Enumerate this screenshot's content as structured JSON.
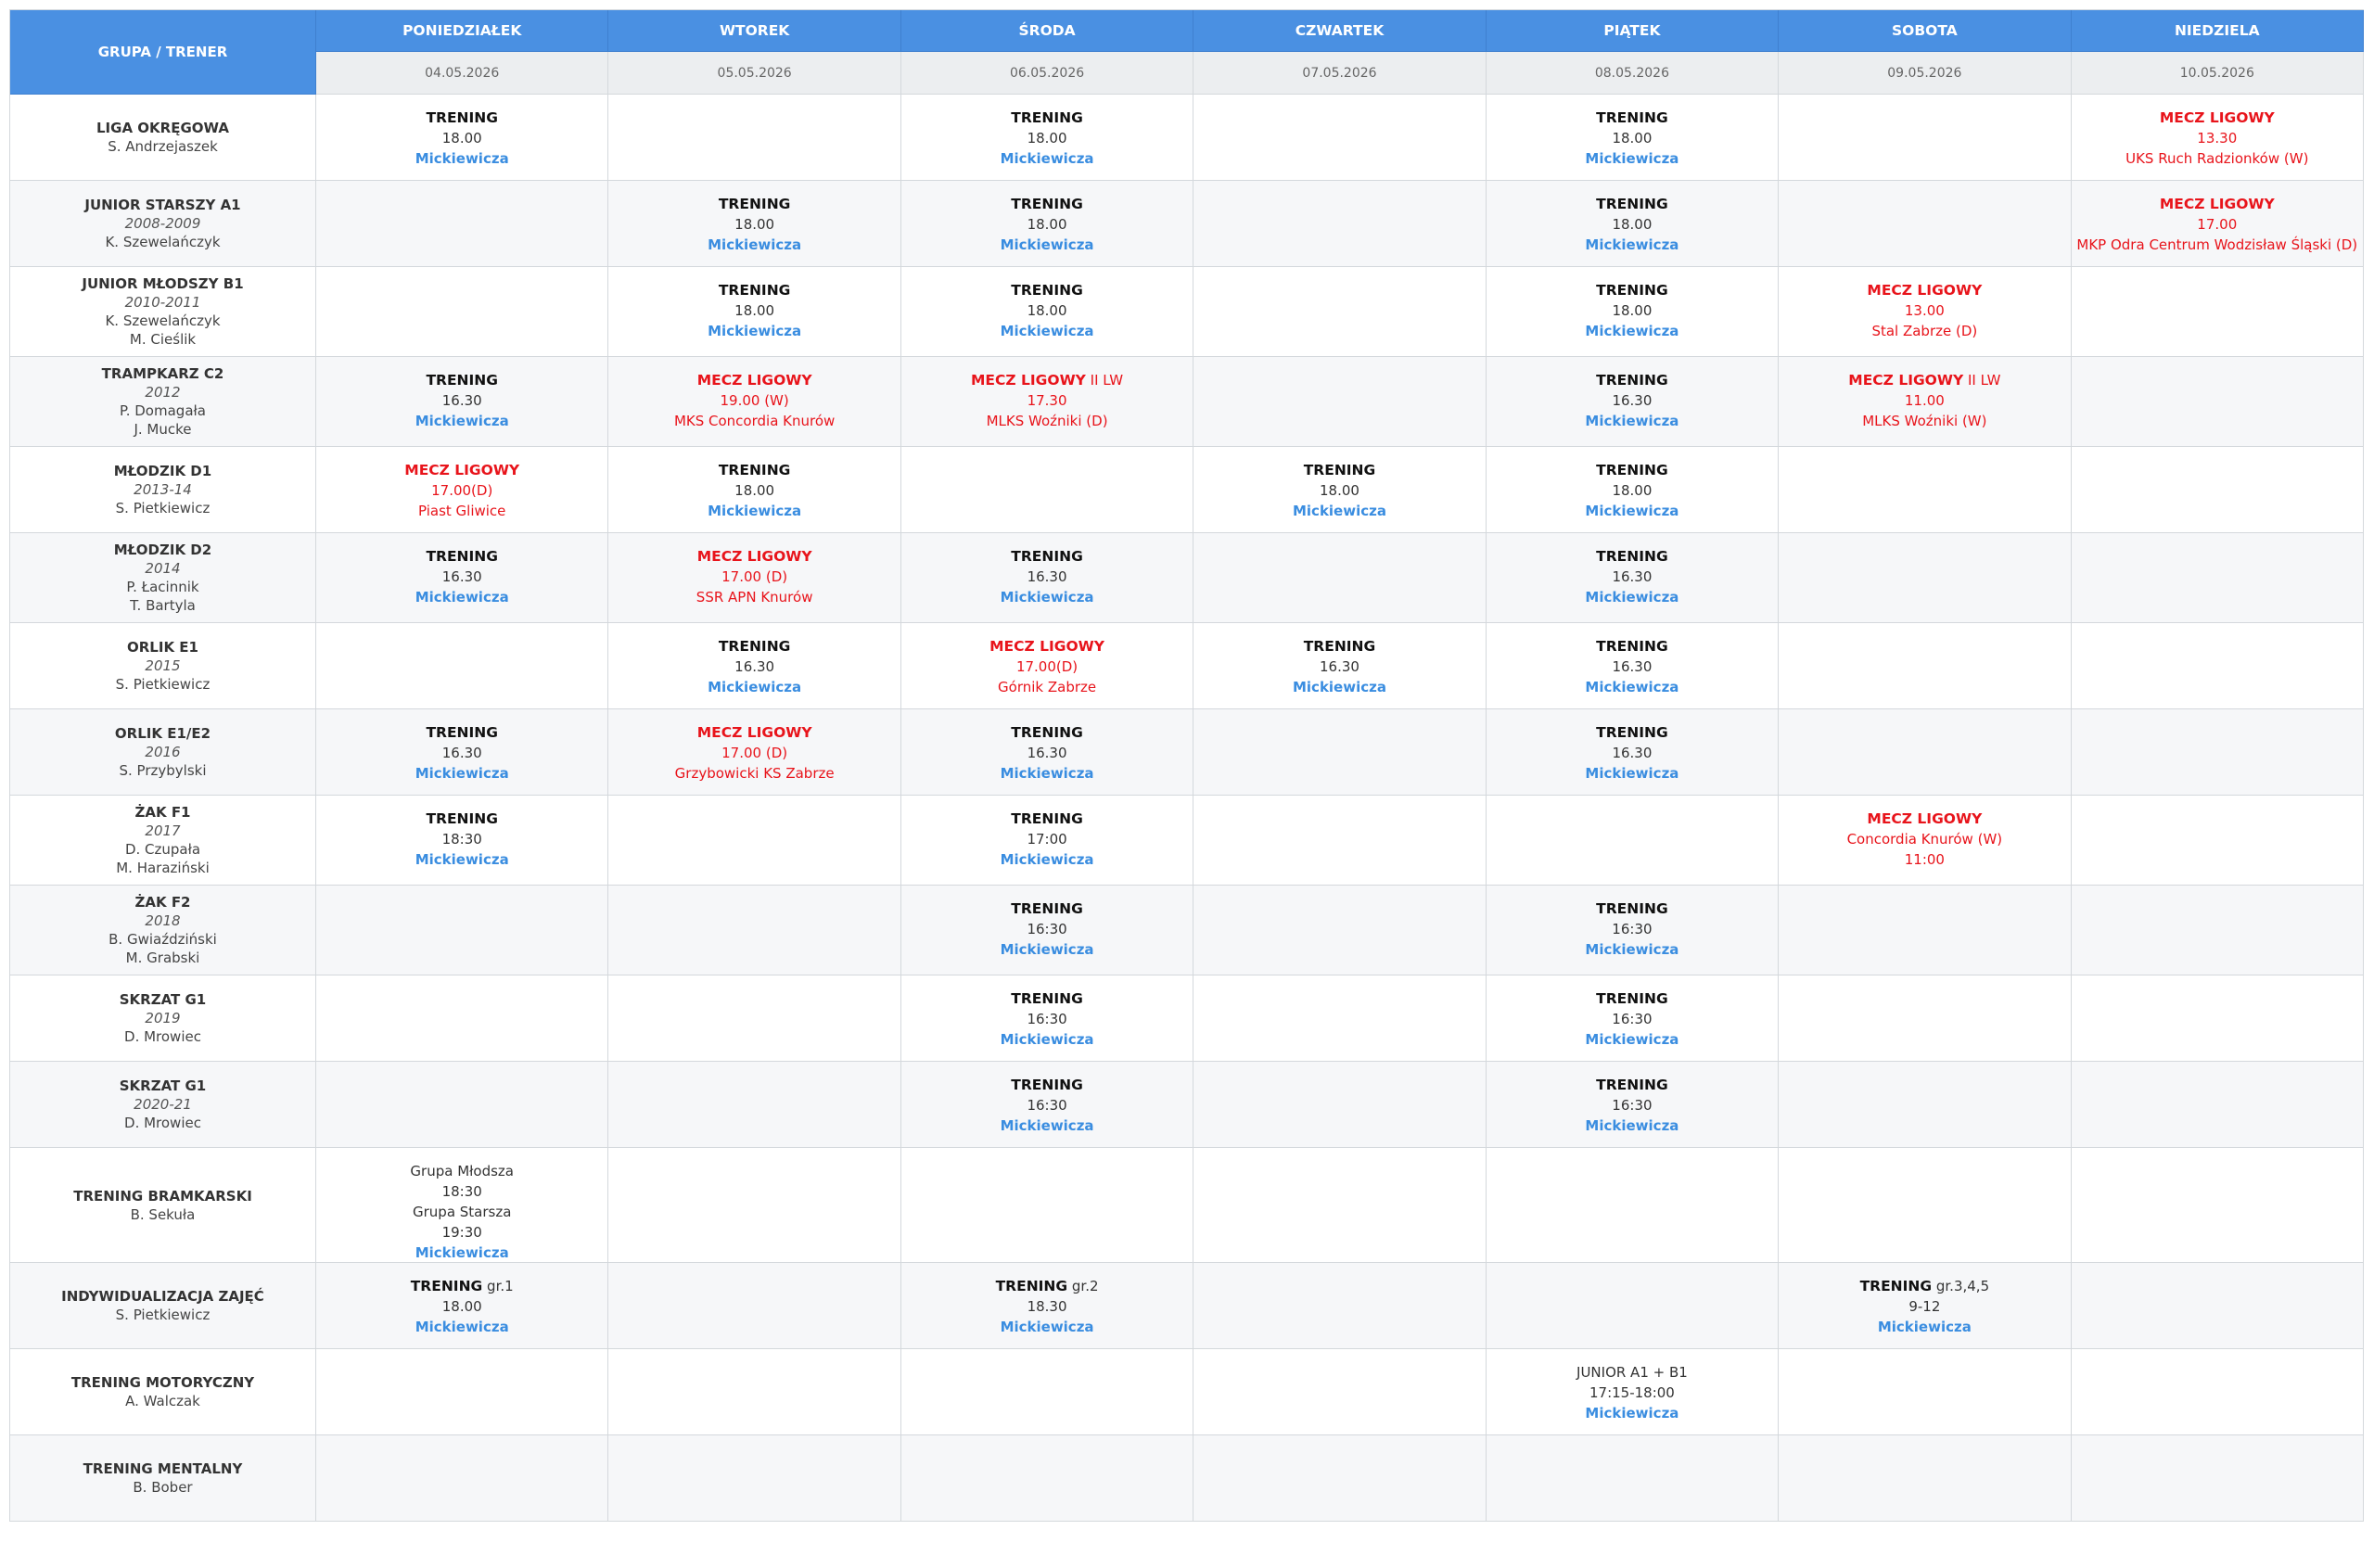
{
  "header": {
    "corner_label": "GRUPA / TRENER",
    "days": [
      {
        "name": "PONIEDZIAŁEK",
        "date": "04.05.2026"
      },
      {
        "name": "WTOREK",
        "date": "05.05.2026"
      },
      {
        "name": "ŚRODA",
        "date": "06.05.2026"
      },
      {
        "name": "CZWARTEK",
        "date": "07.05.2026"
      },
      {
        "name": "PIĄTEK",
        "date": "08.05.2026"
      },
      {
        "name": "SOBOTA",
        "date": "09.05.2026"
      },
      {
        "name": "NIEDZIELA",
        "date": "10.05.2026"
      }
    ]
  },
  "rows": [
    {
      "group": {
        "name": "LIGA OKRĘGOWA",
        "years": "",
        "coaches": [
          "S. Andrzejaszek"
        ]
      },
      "cells": [
        {
          "type": "training",
          "label": "TRENING",
          "time": "18.00",
          "location": "Mickiewicza"
        },
        null,
        {
          "type": "training",
          "label": "TRENING",
          "time": "18.00",
          "location": "Mickiewicza"
        },
        null,
        {
          "type": "training",
          "label": "TRENING",
          "time": "18.00",
          "location": "Mickiewicza"
        },
        null,
        {
          "type": "match",
          "label": "MECZ LIGOWY",
          "time": "13.30",
          "opponent": "UKS Ruch Radzionków (W)"
        }
      ]
    },
    {
      "group": {
        "name": "JUNIOR STARSZY A1",
        "years": "2008-2009",
        "coaches": [
          "K. Szewelańczyk"
        ]
      },
      "cells": [
        null,
        {
          "type": "training",
          "label": "TRENING",
          "time": "18.00",
          "location": "Mickiewicza"
        },
        {
          "type": "training",
          "label": "TRENING",
          "time": "18.00",
          "location": "Mickiewicza"
        },
        null,
        {
          "type": "training",
          "label": "TRENING",
          "time": "18.00",
          "location": "Mickiewicza"
        },
        null,
        {
          "type": "match",
          "label": "MECZ LIGOWY",
          "time": "17.00",
          "opponent": "MKP Odra Centrum Wodzisław Śląski (D)"
        }
      ]
    },
    {
      "group": {
        "name": "JUNIOR MŁODSZY B1",
        "years": "2010-2011",
        "coaches": [
          "K. Szewelańczyk",
          "M. Cieślik"
        ]
      },
      "cells": [
        null,
        {
          "type": "training",
          "label": "TRENING",
          "time": "18.00",
          "location": "Mickiewicza"
        },
        {
          "type": "training",
          "label": "TRENING",
          "time": "18.00",
          "location": "Mickiewicza"
        },
        null,
        {
          "type": "training",
          "label": "TRENING",
          "time": "18.00",
          "location": "Mickiewicza"
        },
        {
          "type": "match",
          "label": "MECZ LIGOWY",
          "time": "13.00",
          "opponent": "Stal Zabrze (D)"
        },
        null
      ]
    },
    {
      "group": {
        "name": "TRAMPKARZ C2",
        "years": "2012",
        "coaches": [
          "P. Domagała",
          "J. Mucke"
        ]
      },
      "cells": [
        {
          "type": "training",
          "label": "TRENING",
          "time": "16.30",
          "location": "Mickiewicza"
        },
        {
          "type": "match",
          "label": "MECZ LIGOWY",
          "time": "19.00 (W)",
          "opponent": "MKS Concordia Knurów"
        },
        {
          "type": "match",
          "label": "MECZ LIGOWY",
          "note": "II LW",
          "time": "17.30",
          "opponent": "MLKS Woźniki (D)"
        },
        null,
        {
          "type": "training",
          "label": "TRENING",
          "time": "16.30",
          "location": "Mickiewicza"
        },
        {
          "type": "match",
          "label": "MECZ LIGOWY",
          "note": "II LW",
          "time": "11.00",
          "opponent": "MLKS Woźniki (W)"
        },
        null
      ]
    },
    {
      "group": {
        "name": "MŁODZIK D1",
        "years": "2013-14",
        "coaches": [
          "S. Pietkiewicz"
        ]
      },
      "cells": [
        {
          "type": "match",
          "label": "MECZ LIGOWY",
          "time": "17.00(D)",
          "opponent": "Piast Gliwice"
        },
        {
          "type": "training",
          "label": "TRENING",
          "time": "18.00",
          "location": "Mickiewicza"
        },
        null,
        {
          "type": "training",
          "label": "TRENING",
          "time": "18.00",
          "location": "Mickiewicza"
        },
        {
          "type": "training",
          "label": "TRENING",
          "time": "18.00",
          "location": "Mickiewicza"
        },
        null,
        null
      ]
    },
    {
      "group": {
        "name": "MŁODZIK D2",
        "years": "2014",
        "coaches": [
          "P. Łacinnik",
          "T. Bartyla"
        ]
      },
      "cells": [
        {
          "type": "training",
          "label": "TRENING",
          "time": "16.30",
          "location": "Mickiewicza"
        },
        {
          "type": "match",
          "label": "MECZ LIGOWY",
          "time": "17.00 (D)",
          "opponent": "SSR APN Knurów"
        },
        {
          "type": "training",
          "label": "TRENING",
          "time": "16.30",
          "location": "Mickiewicza"
        },
        null,
        {
          "type": "training",
          "label": "TRENING",
          "time": "16.30",
          "location": "Mickiewicza"
        },
        null,
        null
      ]
    },
    {
      "group": {
        "name": "ORLIK E1",
        "years": "2015",
        "coaches": [
          "S. Pietkiewicz"
        ]
      },
      "cells": [
        null,
        {
          "type": "training",
          "label": "TRENING",
          "time": "16.30",
          "location": "Mickiewicza"
        },
        {
          "type": "match",
          "label": "MECZ LIGOWY",
          "time": "17.00(D)",
          "opponent": "Górnik Zabrze"
        },
        {
          "type": "training",
          "label": "TRENING",
          "time": "16.30",
          "location": "Mickiewicza"
        },
        {
          "type": "training",
          "label": "TRENING",
          "time": "16.30",
          "location": "Mickiewicza"
        },
        null,
        null
      ]
    },
    {
      "group": {
        "name": "ORLIK E1/E2",
        "years": "2016",
        "coaches": [
          "S. Przybylski"
        ]
      },
      "cells": [
        {
          "type": "training",
          "label": "TRENING",
          "time": "16.30",
          "location": "Mickiewicza"
        },
        {
          "type": "match",
          "label": "MECZ LIGOWY",
          "time": "17.00 (D)",
          "opponent": "Grzybowicki KS Zabrze"
        },
        {
          "type": "training",
          "label": "TRENING",
          "time": "16.30",
          "location": "Mickiewicza"
        },
        null,
        {
          "type": "training",
          "label": "TRENING",
          "time": "16.30",
          "location": "Mickiewicza"
        },
        null,
        null
      ]
    },
    {
      "group": {
        "name": "ŻAK F1",
        "years": "2017",
        "coaches": [
          "D. Czupała",
          "M. Haraziński"
        ]
      },
      "cells": [
        {
          "type": "training",
          "label": "TRENING",
          "time": "18:30",
          "location": "Mickiewicza"
        },
        null,
        {
          "type": "training",
          "label": "TRENING",
          "time": "17:00",
          "location": "Mickiewicza"
        },
        null,
        null,
        {
          "type": "match",
          "label": "MECZ LIGOWY",
          "opponent_first": "Concordia Knurów (W)",
          "time": "11:00"
        },
        null
      ]
    },
    {
      "group": {
        "name": "ŻAK F2",
        "years": "2018",
        "coaches": [
          "B. Gwiaździński",
          "M. Grabski"
        ]
      },
      "cells": [
        null,
        null,
        {
          "type": "training",
          "label": "TRENING",
          "time": "16:30",
          "location": "Mickiewicza"
        },
        null,
        {
          "type": "training",
          "label": "TRENING",
          "time": "16:30",
          "location": "Mickiewicza"
        },
        null,
        null
      ]
    },
    {
      "group": {
        "name": "SKRZAT G1",
        "years": "2019",
        "coaches": [
          "D. Mrowiec"
        ]
      },
      "cells": [
        null,
        null,
        {
          "type": "training",
          "label": "TRENING",
          "time": "16:30",
          "location": "Mickiewicza"
        },
        null,
        {
          "type": "training",
          "label": "TRENING",
          "time": "16:30",
          "location": "Mickiewicza"
        },
        null,
        null
      ]
    },
    {
      "group": {
        "name": "SKRZAT G1",
        "years": "2020-21",
        "coaches": [
          "D. Mrowiec"
        ]
      },
      "cells": [
        null,
        null,
        {
          "type": "training",
          "label": "TRENING",
          "time": "16:30",
          "location": "Mickiewicza"
        },
        null,
        {
          "type": "training",
          "label": "TRENING",
          "time": "16:30",
          "location": "Mickiewicza"
        },
        null,
        null
      ]
    },
    {
      "group": {
        "name": "TRENING BRAMKARSKI",
        "years": "",
        "coaches": [
          "B. Sekuła"
        ]
      },
      "cells": [
        {
          "type": "plain",
          "lines": [
            "Grupa Młodsza",
            "18:30",
            "Grupa Starsza",
            "19:30"
          ],
          "location": "Mickiewicza"
        },
        null,
        null,
        null,
        null,
        null,
        null
      ]
    },
    {
      "group": {
        "name": "INDYWIDUALIZACJA ZAJĘĆ",
        "years": "",
        "coaches": [
          "S. Pietkiewicz"
        ]
      },
      "cells": [
        {
          "type": "training",
          "label": "TRENING",
          "note": "gr.1",
          "time": "18.00",
          "location": "Mickiewicza"
        },
        null,
        {
          "type": "training",
          "label": "TRENING",
          "note": "gr.2",
          "time": "18.30",
          "location": "Mickiewicza"
        },
        null,
        null,
        {
          "type": "training",
          "label": "TRENING",
          "note": "gr.3,4,5",
          "time": "9-12",
          "location": "Mickiewicza"
        },
        null
      ]
    },
    {
      "group": {
        "name": "TRENING MOTORYCZNY",
        "years": "",
        "coaches": [
          "A. Walczak"
        ]
      },
      "cells": [
        null,
        null,
        null,
        null,
        {
          "type": "plain",
          "lines": [
            "JUNIOR A1 + B1",
            "17:15-18:00"
          ],
          "location": "Mickiewicza"
        },
        null,
        null
      ]
    },
    {
      "group": {
        "name": "TRENING MENTALNY",
        "years": "",
        "coaches": [
          "B. Bober"
        ]
      },
      "cells": [
        null,
        null,
        null,
        null,
        null,
        null,
        null
      ]
    }
  ]
}
